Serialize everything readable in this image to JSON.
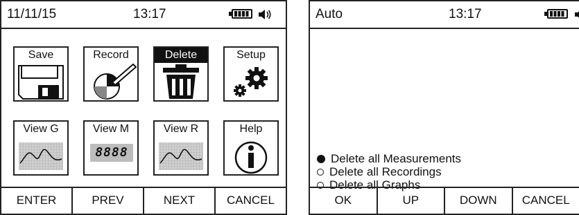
{
  "left_screen": {
    "status": {
      "date": "11/11/15",
      "time": "13:17",
      "battery_icon": "battery-full-icon",
      "speaker_icon": "speaker-icon"
    },
    "menu": [
      {
        "label": "Save",
        "icon": "floppy-disk-icon",
        "selected": false
      },
      {
        "label": "Record",
        "icon": "pen-chart-icon",
        "selected": false
      },
      {
        "label": "Delete",
        "icon": "trash-icon",
        "selected": true
      },
      {
        "label": "Setup",
        "icon": "gears-icon",
        "selected": false
      },
      {
        "label": "View G",
        "icon": "graph-icon",
        "selected": false
      },
      {
        "label": "View M",
        "icon": "lcd-digits-icon",
        "selected": false,
        "display": "8888"
      },
      {
        "label": "View R",
        "icon": "graph-icon",
        "selected": false
      },
      {
        "label": "Help",
        "icon": "info-icon",
        "selected": false
      }
    ],
    "softkeys": [
      "ENTER",
      "PREV",
      "NEXT",
      "CANCEL"
    ]
  },
  "right_screen": {
    "status": {
      "mode": "Auto",
      "time": "13:17",
      "battery_icon": "battery-full-icon",
      "speaker_icon": "speaker-icon"
    },
    "options": [
      {
        "label": "Delete all Measurements",
        "selected": true
      },
      {
        "label": "Delete all Recordings",
        "selected": false
      },
      {
        "label": "Delete all Graphs",
        "selected": false
      }
    ],
    "softkeys": [
      "OK",
      "UP",
      "DOWN",
      "CANCEL"
    ]
  }
}
